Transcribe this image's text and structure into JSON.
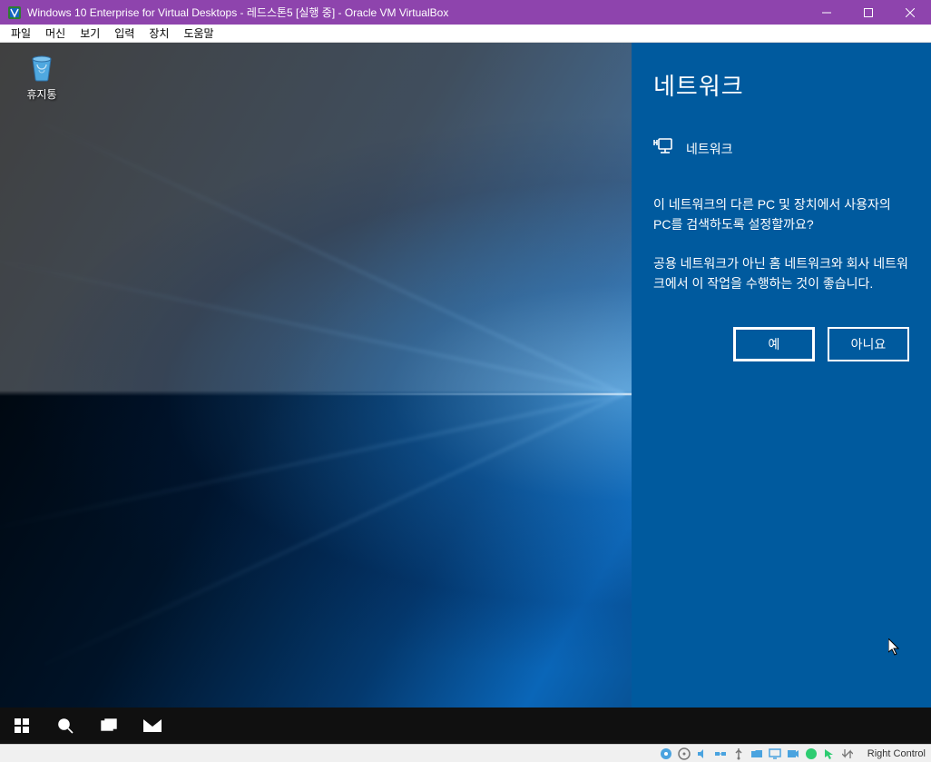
{
  "vbox": {
    "title": "Windows 10 Enterprise for Virtual Desktops - 레드스톤5 [실행 중] - Oracle VM VirtualBox",
    "menu": {
      "file": "파일",
      "machine": "머신",
      "view": "보기",
      "input": "입력",
      "devices": "장치",
      "help": "도움말"
    },
    "hostkey": "Right Control"
  },
  "desktop": {
    "recycle_bin": "휴지통"
  },
  "network_panel": {
    "title": "네트워크",
    "section": "네트워크",
    "body1": "이 네트워크의 다른 PC 및 장치에서 사용자의 PC를 검색하도록 설정할까요?",
    "body2": "공용 네트워크가 아닌 홈 네트워크와 회사 네트워크에서 이 작업을 수행하는 것이 좋습니다.",
    "yes": "예",
    "no": "아니요"
  }
}
